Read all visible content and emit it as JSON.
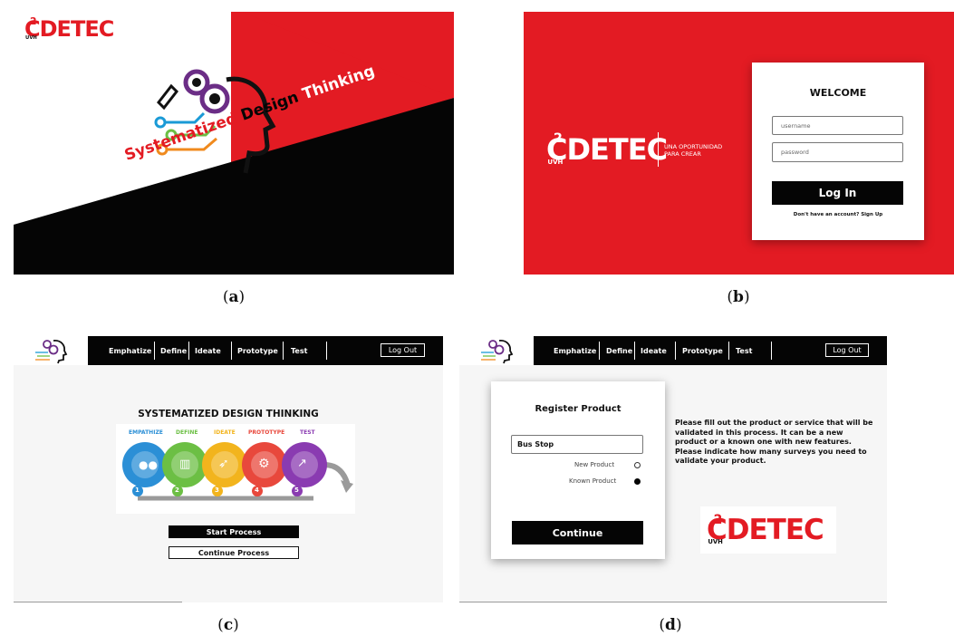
{
  "captions": {
    "a": "a",
    "b": "b",
    "c": "c",
    "d": "d"
  },
  "brand": {
    "name": "DETEC",
    "superscript": "2",
    "tag": "UVH",
    "slogan_line1": "UNA OPORTUNIDAD",
    "slogan_line2": "PARA CREAR"
  },
  "colors": {
    "brand_red": "#e31b23",
    "black": "#050505",
    "empathize": "#2b8fd6",
    "define": "#6cbf44",
    "ideate": "#f2b41d",
    "prototype": "#e8483c",
    "test": "#8a3bb1"
  },
  "panel_a": {
    "title_part1": "Systematized",
    "title_part2": "Design",
    "title_part3": "Thinking"
  },
  "panel_b": {
    "welcome": "WELCOME",
    "username_placeholder": "username",
    "password_placeholder": "password",
    "login_label": "Log In",
    "signup_text": "Don't have an account? Sign Up"
  },
  "nav": {
    "items": [
      "Emphatize",
      "Define",
      "Ideate",
      "Prototype",
      "Test"
    ],
    "logout_label": "Log Out"
  },
  "panel_c": {
    "heading": "SYSTEMATIZED DESIGN THINKING",
    "stages": [
      "EMPATHIZE",
      "DEFINE",
      "IDEATE",
      "PROTOTYPE",
      "TEST"
    ],
    "stage_numbers": [
      "1",
      "2",
      "3",
      "4",
      "5"
    ],
    "start_label": "Start Process",
    "continue_label": "Continue Process"
  },
  "panel_d": {
    "register_title": "Register Product",
    "product_value": "Bus Stop",
    "new_product_label": "New Product",
    "known_product_label": "Known Product",
    "selected_option": "Known Product",
    "continue_label": "Continue",
    "instructions": "Please fill out the product or service that will be validated in this process. It can be a new product or a known one with new features. Please indicate how many surveys you need to validate your product."
  }
}
